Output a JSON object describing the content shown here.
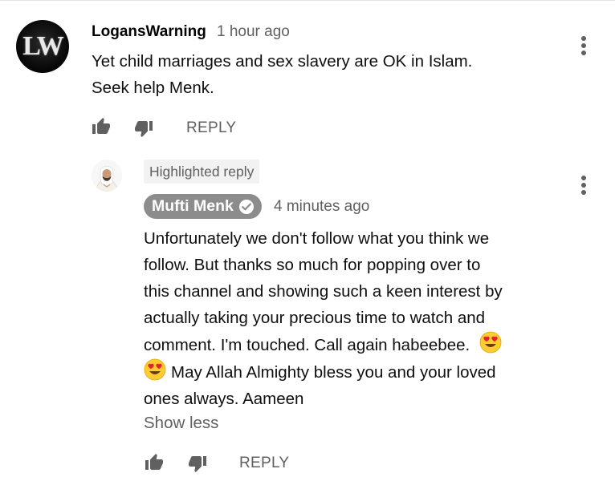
{
  "comment": {
    "avatar_text": "LW",
    "author": "LogansWarning",
    "time": "1 hour ago",
    "text_line1": "Yet child marriages and sex slavery are OK in Islam.",
    "text_line2": "Seek help Menk.",
    "reply_label": "REPLY"
  },
  "reply": {
    "badge": "Highlighted reply",
    "author": "Mufti Menk",
    "verified": true,
    "time": "4 minutes ago",
    "lines": [
      "Unfortunately we don't follow what you think we",
      "follow. But thanks so much for popping over to",
      "this channel and showing such a keen interest by",
      "actually taking your precious time to watch and",
      "comment. I'm touched. Call again habeebee.",
      "May Allah Almighty bless you and your loved",
      "ones always. Aameen"
    ],
    "show_less": "Show less",
    "reply_label": "REPLY"
  },
  "icons": {
    "like": "thumbs-up-icon",
    "dislike": "thumbs-down-icon",
    "more": "more-vertical-icon",
    "emoji": "heart-eyes-emoji"
  },
  "colors": {
    "secondary_text": "#606060",
    "chip_bg": "#8c8c8c",
    "badge_bg": "#f2f2f2"
  }
}
